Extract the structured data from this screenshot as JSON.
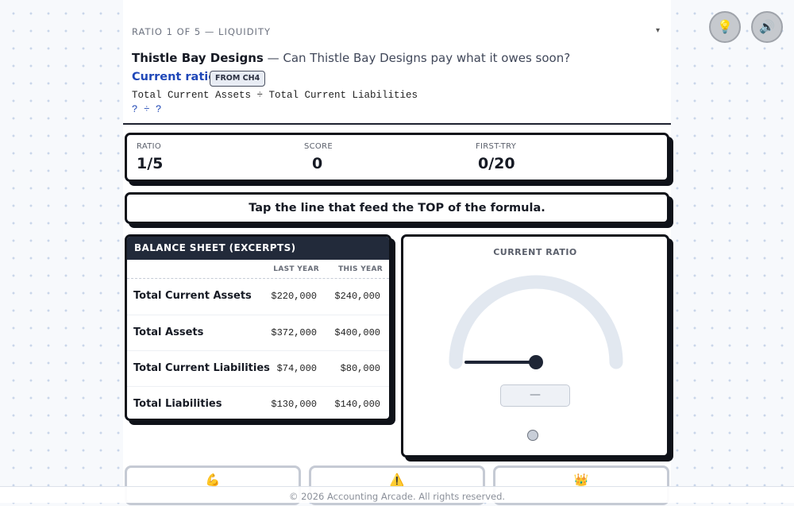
{
  "header": {
    "progress_label": "RATIO 1 OF 5 — LIQUIDITY",
    "caret": "▾",
    "company": "Thistle Bay Designs",
    "question": " — Can Thistle Bay Designs pay what it owes soon?",
    "ratio_name": "Current ratio",
    "badge": "FROM CH4",
    "formula": "Total Current Assets ÷ Total Current Liabilities",
    "formula_placeholder": "? ÷ ?"
  },
  "stats": [
    {
      "label": "RATIO",
      "value": "1/5"
    },
    {
      "label": "SCORE",
      "value": "0"
    },
    {
      "label": "FIRST-TRY",
      "value": "0/20"
    }
  ],
  "prompt": "Tap the line that feed the TOP of the formula.",
  "balance_sheet": {
    "title": "BALANCE SHEET (EXCERPTS)",
    "columns": [
      "LAST YEAR",
      "THIS YEAR"
    ],
    "rows": [
      {
        "name": "Total Current Assets",
        "last": "$220,000",
        "this": "$240,000"
      },
      {
        "name": "Total Assets",
        "last": "$372,000",
        "this": "$400,000"
      },
      {
        "name": "Total Current Liabilities",
        "last": "$74,000",
        "this": "$80,000"
      },
      {
        "name": "Total Liabilities",
        "last": "$130,000",
        "this": "$140,000"
      }
    ]
  },
  "gauge": {
    "title": "CURRENT RATIO",
    "readout": "—",
    "needle_fraction": 0
  },
  "tiles": [
    {
      "icon": "flexed-biceps-icon",
      "glyph": "💪"
    },
    {
      "icon": "warning-icon",
      "glyph": "⚠️"
    },
    {
      "icon": "crown-icon",
      "glyph": "👑"
    }
  ],
  "top_buttons": [
    {
      "icon": "lightbulb-icon",
      "glyph": "💡"
    },
    {
      "icon": "speaker-icon",
      "glyph": "🔊"
    }
  ],
  "footer": "© 2026 Accounting Arcade. All rights reserved.",
  "colors": {
    "accent": "#1f47b8",
    "dark": "#0f1219",
    "sheet_header": "#222a3a",
    "gauge_track": "#e2e8f0"
  }
}
